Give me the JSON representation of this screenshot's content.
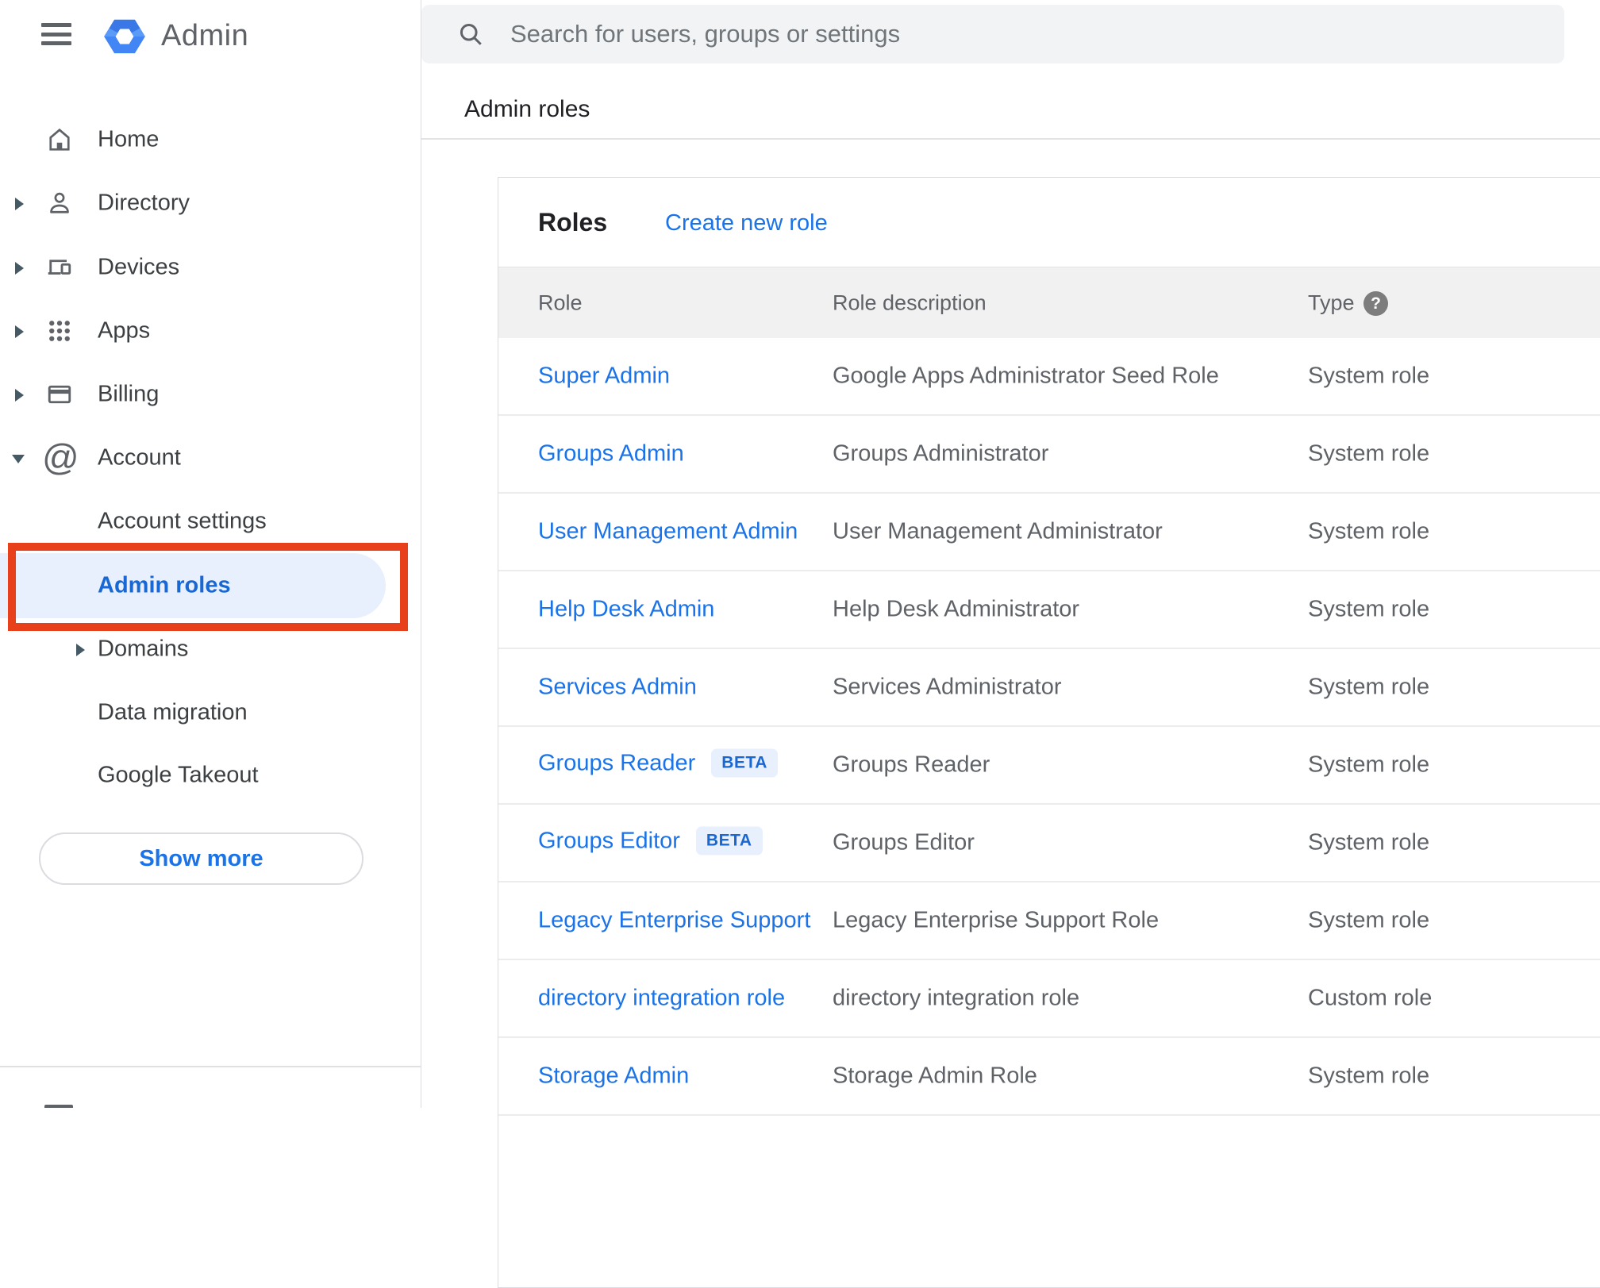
{
  "app": {
    "logo_text": "Admin"
  },
  "topbar": {
    "search_placeholder": "Search for users, groups or settings"
  },
  "breadcrumb": "Admin roles",
  "sidebar": {
    "items": [
      {
        "label": "Home",
        "expandable": false
      },
      {
        "label": "Directory",
        "expandable": true
      },
      {
        "label": "Devices",
        "expandable": true
      },
      {
        "label": "Apps",
        "expandable": true
      },
      {
        "label": "Billing",
        "expandable": true
      },
      {
        "label": "Account",
        "expandable": true,
        "expanded": true
      }
    ],
    "sub_items": [
      {
        "label": "Account settings",
        "selected": false
      },
      {
        "label": "Admin roles",
        "selected": true
      },
      {
        "label": "Domains",
        "expandable": true
      },
      {
        "label": "Data migration"
      },
      {
        "label": "Google Takeout"
      }
    ],
    "show_more": "Show more"
  },
  "main": {
    "card_title": "Roles",
    "create_link": "Create new role",
    "beta_label": "BETA",
    "table": {
      "columns": [
        "Role",
        "Role description",
        "Type"
      ],
      "rows": [
        {
          "role": "Super Admin",
          "beta": false,
          "description": "Google Apps Administrator Seed Role",
          "type": "System role"
        },
        {
          "role": "Groups Admin",
          "beta": false,
          "description": "Groups Administrator",
          "type": "System role"
        },
        {
          "role": "User Management Admin",
          "beta": false,
          "description": "User Management Administrator",
          "type": "System role"
        },
        {
          "role": "Help Desk Admin",
          "beta": false,
          "description": "Help Desk Administrator",
          "type": "System role"
        },
        {
          "role": "Services Admin",
          "beta": false,
          "description": "Services Administrator",
          "type": "System role"
        },
        {
          "role": "Groups Reader",
          "beta": true,
          "description": "Groups Reader",
          "type": "System role"
        },
        {
          "role": "Groups Editor",
          "beta": true,
          "description": "Groups Editor",
          "type": "System role"
        },
        {
          "role": "Legacy Enterprise Support",
          "beta": false,
          "description": "Legacy Enterprise Support Role",
          "type": "System role"
        },
        {
          "role": "directory integration role",
          "beta": false,
          "description": "directory integration role",
          "type": "Custom role"
        },
        {
          "role": "Storage Admin",
          "beta": false,
          "description": "Storage Admin Role",
          "type": "System role"
        }
      ]
    }
  },
  "colors": {
    "link_blue": "#1a73e8",
    "selected_blue": "#1967d2",
    "selected_bg": "#e8f0fe",
    "annotation_red": "#e8401a",
    "beta_bg": "#e8f0fe",
    "beta_text": "#1967d2",
    "header_bg": "#f1f1f1"
  }
}
